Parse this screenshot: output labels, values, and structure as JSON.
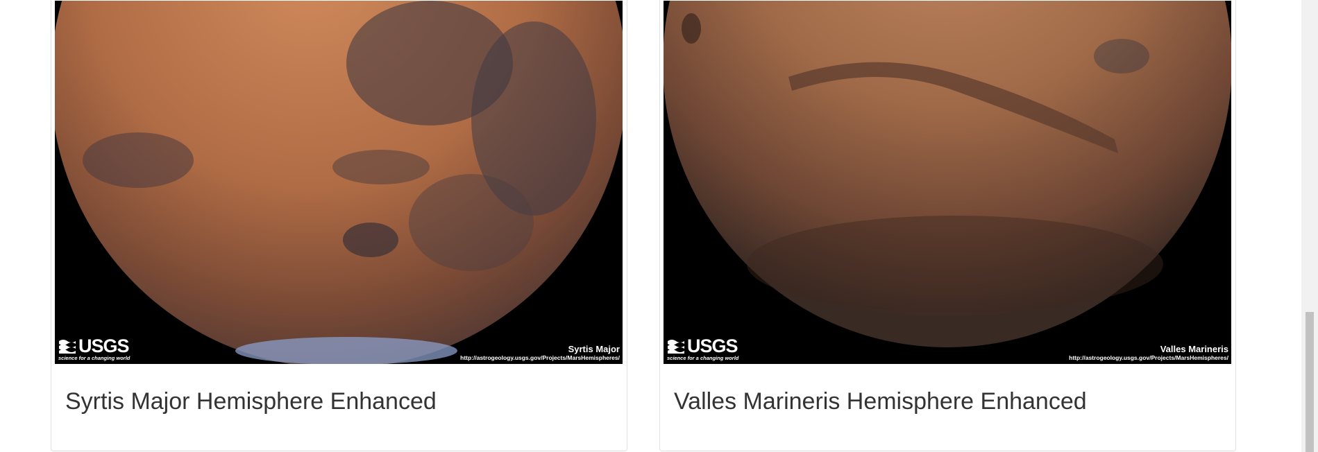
{
  "cards": [
    {
      "title": "Syrtis Major Hemisphere Enhanced",
      "image": {
        "overlay_logo": "USGS",
        "overlay_tagline": "science for a changing world",
        "overlay_caption": "Syrtis Major",
        "overlay_url": "http://astrogeology.usgs.gov/Projects/MarsHemispheres/"
      }
    },
    {
      "title": "Valles Marineris Hemisphere Enhanced",
      "image": {
        "overlay_logo": "USGS",
        "overlay_tagline": "science for a changing world",
        "overlay_caption": "Valles Marineris",
        "overlay_url": "http://astrogeology.usgs.gov/Projects/MarsHemispheres/"
      }
    }
  ],
  "colors": {
    "page_bg": "#ffffff",
    "card_border": "#dfdfdf",
    "title_text": "#333333",
    "scrollbar_track": "#f1f1f1",
    "scrollbar_thumb": "#c1c1c1"
  }
}
